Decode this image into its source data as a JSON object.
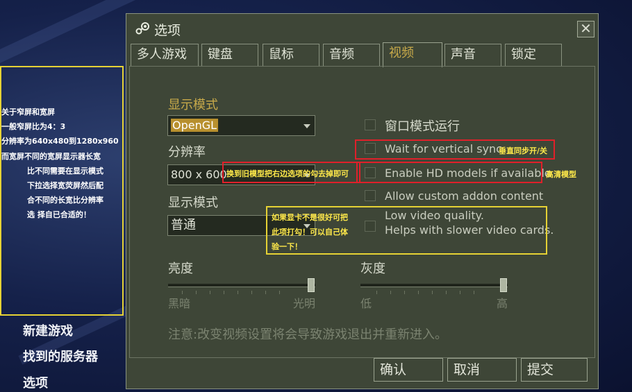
{
  "dialog": {
    "title": "选项",
    "close_label": "✕",
    "tabs": [
      "多人游戏",
      "键盘",
      "鼠标",
      "音频",
      "视频",
      "声音",
      "锁定"
    ]
  },
  "video": {
    "display_mode_label": "显示模式",
    "display_mode_value": "OpenGL",
    "resolution_label": "分辨率",
    "resolution_value": "800 x 600",
    "display_mode2_label": "显示模式",
    "display_mode2_value": "普通",
    "brightness_label": "亮度",
    "brightness_min": "黑暗",
    "brightness_max": "光明",
    "brightness_level": 0.97,
    "gamma_label": "灰度",
    "gamma_min": "低",
    "gamma_max": "高",
    "gamma_level": 0.97,
    "options": [
      "窗口模式运行",
      "Wait for vertical sync",
      "Enable HD models if available",
      "Allow custom addon content"
    ],
    "low_quality_line1": "Low video quality.",
    "low_quality_line2": "Helps with slower video cards.",
    "note": "注意:改变视频设置将会导致游戏退出并重新进入。"
  },
  "buttons": {
    "ok": "确认",
    "cancel": "取消",
    "submit": "提交"
  },
  "annotations": {
    "vsync": "垂直同步开/关",
    "hd_models": "高清模型",
    "old_models": "换到旧模型把右边选项的勾去掉即可",
    "low_quality": [
      "如果显卡不是很好可把",
      "此项打勾！可以自己体",
      "验一下！"
    ],
    "left_box": [
      "关于窄屏和宽屏",
      "一般窄屏比为4：3",
      "分辨率为640x480到1280x960",
      "而宽屏不同的宽屏显示器长宽",
      "比不同需要在显示模式",
      "下拉选择宽荧屏然后配",
      "合不同的长宽比分辨率",
      "选 择自已合适的！"
    ]
  },
  "menu": [
    "新建游戏",
    "找到的服务器",
    "选项"
  ]
}
